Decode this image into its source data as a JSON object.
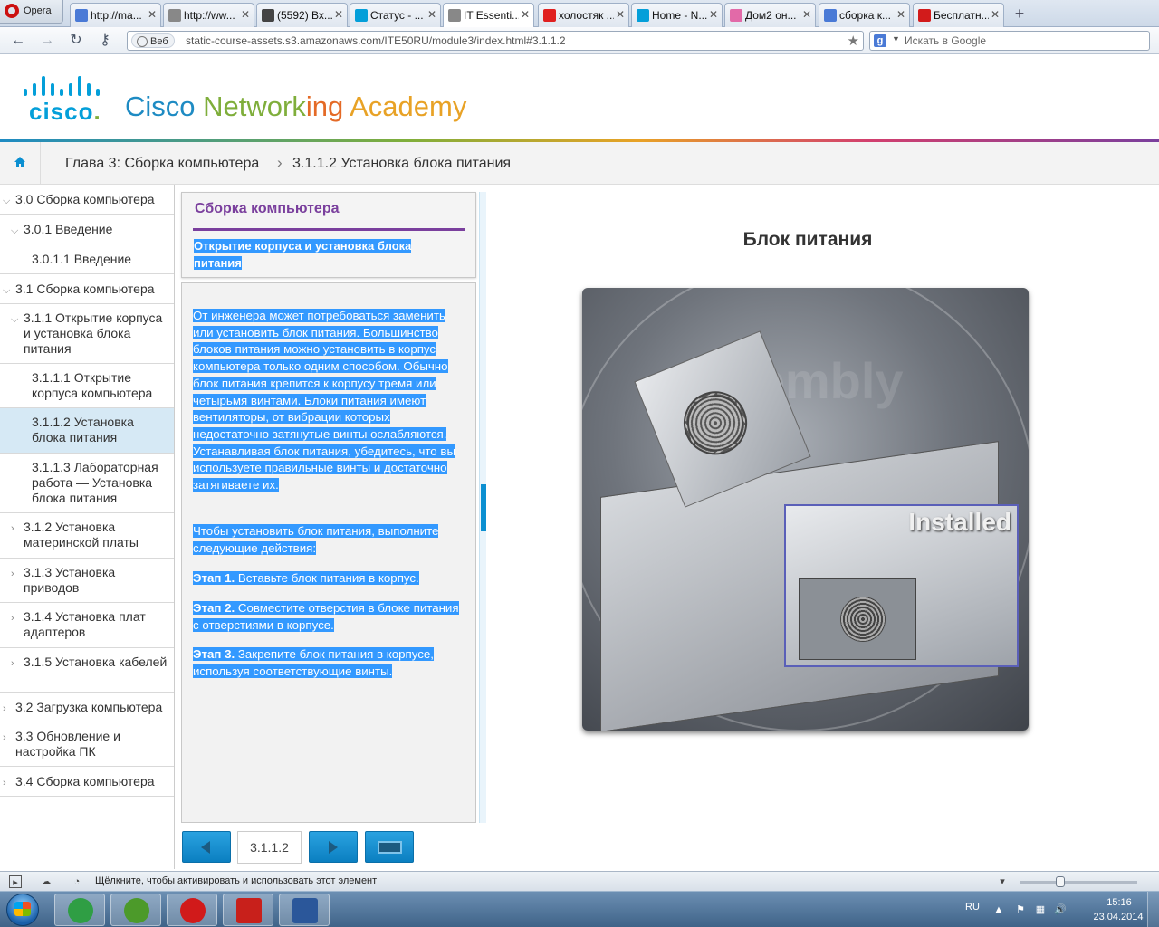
{
  "browser": {
    "menu_label": "Opera",
    "tabs": [
      {
        "label": "http://ma...",
        "icon": "opera-icon",
        "color": "#4a7ad6"
      },
      {
        "label": "http://ww...",
        "icon": "page-icon",
        "color": "#888888"
      },
      {
        "label": "(5592) Вх...",
        "icon": "mail-icon",
        "color": "#444444"
      },
      {
        "label": "Статус - ...",
        "icon": "cisco-icon",
        "color": "#049fd9"
      },
      {
        "label": "IT Essenti...",
        "icon": "page-icon",
        "color": "#888888"
      },
      {
        "label": "холостяк ...",
        "icon": "yandex-icon",
        "color": "#e02020"
      },
      {
        "label": "Home - N...",
        "icon": "cisco-icon",
        "color": "#049fd9"
      },
      {
        "label": "Дом2 он...",
        "icon": "flower-icon",
        "color": "#e26aa8"
      },
      {
        "label": "сборка к...",
        "icon": "google-icon",
        "color": "#4a7ad6"
      },
      {
        "label": "Бесплатн...",
        "icon": "youtube-icon",
        "color": "#d21b1b"
      }
    ],
    "active_tab": 4,
    "web_badge": "Веб",
    "url": "static-course-assets.s3.amazonaws.com/ITE50RU/module3/index.html#3.1.1.2",
    "search_placeholder": "Искать в Google",
    "search_engine_letter": "g",
    "status_text": "Щёлкните, чтобы активировать и использовать этот элемент"
  },
  "header": {
    "logo_word": "cisco",
    "logo_dot": ".",
    "title_parts": [
      "Cisco ",
      "Network",
      "ing ",
      "Academy"
    ]
  },
  "breadcrumb": {
    "chapter": "Глава 3: Сборка компьютера",
    "separator": "›",
    "section": "3.1.1.2 Установка блока питания"
  },
  "nav": {
    "items": [
      {
        "label": "3.0 Сборка компьютера",
        "chevron": "v",
        "level": 0
      },
      {
        "label": "3.0.1 Введение",
        "chevron": "v",
        "level": 1
      },
      {
        "label": "3.0.1.1 Введение",
        "chevron": "",
        "level": 2
      },
      {
        "label": "3.1 Сборка компьютера",
        "chevron": "v",
        "level": 0
      },
      {
        "label": "3.1.1 Открытие корпуса и установка блока питания",
        "chevron": "v",
        "level": 1
      },
      {
        "label": "3.1.1.1 Открытие корпуса компьютера",
        "chevron": "",
        "level": 2
      },
      {
        "label": "3.1.1.2 Установка блока питания",
        "chevron": "",
        "level": 2,
        "selected": true
      },
      {
        "label": "3.1.1.3 Лабораторная работа — Установка блока питания",
        "chevron": "",
        "level": 2
      },
      {
        "label": "3.1.2 Установка материнской платы",
        "chevron": ">",
        "level": 1
      },
      {
        "label": "3.1.3 Установка приводов",
        "chevron": ">",
        "level": 1
      },
      {
        "label": "3.1.4 Установка плат адаптеров",
        "chevron": ">",
        "level": 1
      },
      {
        "label": "3.1.5 Установка кабелей",
        "chevron": ">",
        "level": 1
      },
      {
        "label": "3.2 Загрузка компьютера",
        "chevron": ">",
        "level": 0
      },
      {
        "label": "3.3 Обновление и настройка ПК",
        "chevron": ">",
        "level": 0
      },
      {
        "label": "3.4 Сборка компьютера",
        "chevron": ">",
        "level": 0
      }
    ]
  },
  "panel": {
    "title": "Сборка компьютера",
    "subtitle": "Открытие корпуса и установка блока питания",
    "para1": "От инженера может потребоваться заменить или установить блок питания. Большинство блоков питания можно установить в корпус компьютера только одним способом. Обычно блок питания крепится к корпусу тремя или четырьмя винтами. Блоки питания имеют вентиляторы, от вибрации которых недостаточно затянутые винты ослабляются. Устанавливая блок питания, убедитесь, что вы используете правильные винты и достаточно затягиваете их.",
    "para2": "Чтобы установить блок питания, выполните следующие действия:",
    "steps": [
      {
        "label": "Этап 1.",
        "text": " Вставьте блок питания в корпус."
      },
      {
        "label": "Этап 2.",
        "text": " Совместите отверстия в блоке питания с отверстиями в корпусе."
      },
      {
        "label": "Этап 3.",
        "text": " Закрепите блок питания в корпусе, используя соответствующие винты."
      }
    ],
    "page_number": "3.1.1.2"
  },
  "content": {
    "title": "Блок питания",
    "image_watermark": "Assembly",
    "inset_label": "Installed"
  },
  "taskbar": {
    "apps": [
      {
        "name": "chrome-icon",
        "color": "#2f9e44"
      },
      {
        "name": "utorrent-icon",
        "color": "#4c9a2a"
      },
      {
        "name": "opera-icon",
        "color": "#d11a1a"
      },
      {
        "name": "acrobat-icon",
        "color": "#c8201b"
      },
      {
        "name": "word-icon",
        "color": "#2b579a"
      }
    ],
    "language": "RU",
    "time": "15:16",
    "date": "23.04.2014"
  }
}
